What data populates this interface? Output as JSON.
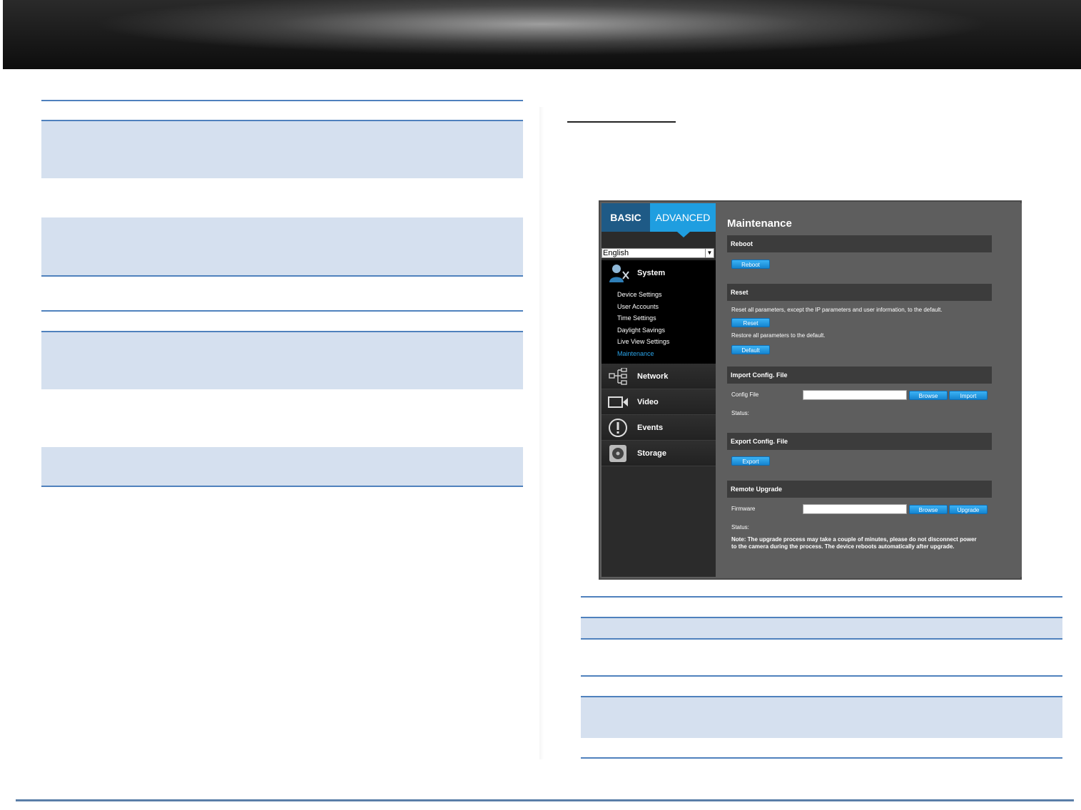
{
  "sidebar": {
    "tabs": [
      {
        "label": "BASIC"
      },
      {
        "label": "ADVANCED"
      }
    ],
    "language": "English",
    "system": {
      "label": "System",
      "items": [
        "Device Settings",
        "User Accounts",
        "Time Settings",
        "Daylight Savings",
        "Live View Settings",
        "Maintenance"
      ],
      "active": "Maintenance"
    },
    "nav": [
      "Network",
      "Video",
      "Events",
      "Storage"
    ]
  },
  "panel": {
    "title": "Maintenance",
    "reboot": {
      "heading": "Reboot",
      "button": "Reboot"
    },
    "reset": {
      "heading": "Reset",
      "reset_text": "Reset all parameters, except the IP parameters and user information, to the default.",
      "reset_button": "Reset",
      "restore_text": "Restore all parameters to the default.",
      "default_button": "Default"
    },
    "import": {
      "heading": "Import Config. File",
      "label": "Config File",
      "browse": "Browse",
      "import_button": "Import",
      "status": "Status:"
    },
    "export": {
      "heading": "Export Config. File",
      "button": "Export"
    },
    "upgrade": {
      "heading": "Remote Upgrade",
      "label": "Firmware",
      "browse": "Browse",
      "upgrade_button": "Upgrade",
      "status": "Status:",
      "note": "Note: The upgrade process may take a couple of minutes, please do not disconnect power to the camera during the process. The device reboots automatically after upgrade."
    }
  },
  "colors": {
    "accent": "#4f81bd",
    "band": "#d5e0ef",
    "ui_blue": "#1f9ee0"
  }
}
